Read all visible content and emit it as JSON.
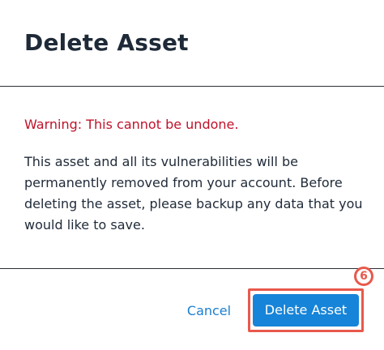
{
  "dialog": {
    "title": "Delete Asset",
    "warning": "Warning: This cannot be undone.",
    "body_lines": [
      "This asset and all its vulnerabilities will be",
      "permanently removed from your account. Before",
      "deleting the asset, please backup any data that you",
      "would like to save."
    ],
    "cancel_label": "Cancel",
    "delete_label": "Delete Asset"
  },
  "annotation": {
    "step_number": "6"
  },
  "colors": {
    "title_text": "#1f2a38",
    "warning_text": "#c0122a",
    "link_blue": "#1a7fd0",
    "primary_button": "#1684d8",
    "annotation_red": "#e8594c"
  }
}
